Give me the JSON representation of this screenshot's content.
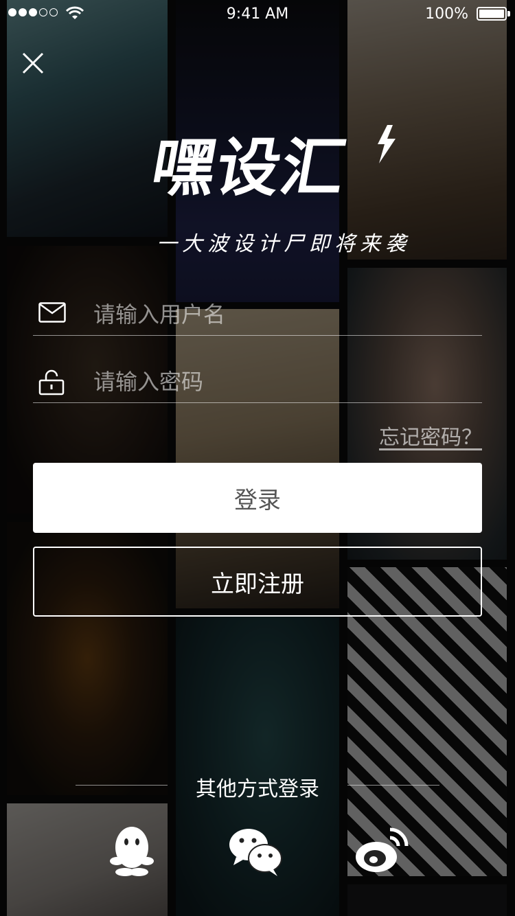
{
  "status_bar": {
    "time": "9:41 AM",
    "battery": "100%"
  },
  "brand": {
    "logo": "嘿设汇",
    "slogan": "一大波设计尸即将来袭"
  },
  "form": {
    "username_placeholder": "请输入用户名",
    "password_placeholder": "请输入密码",
    "forgot_label": "忘记密码？"
  },
  "buttons": {
    "login": "登录",
    "register": "立即注册"
  },
  "other_login": {
    "label": "其他方式登录",
    "providers": [
      "qq-icon",
      "wechat-icon",
      "weibo-icon"
    ]
  },
  "icons": {
    "close": "close-icon",
    "username": "mail-icon",
    "password": "lock-icon"
  }
}
